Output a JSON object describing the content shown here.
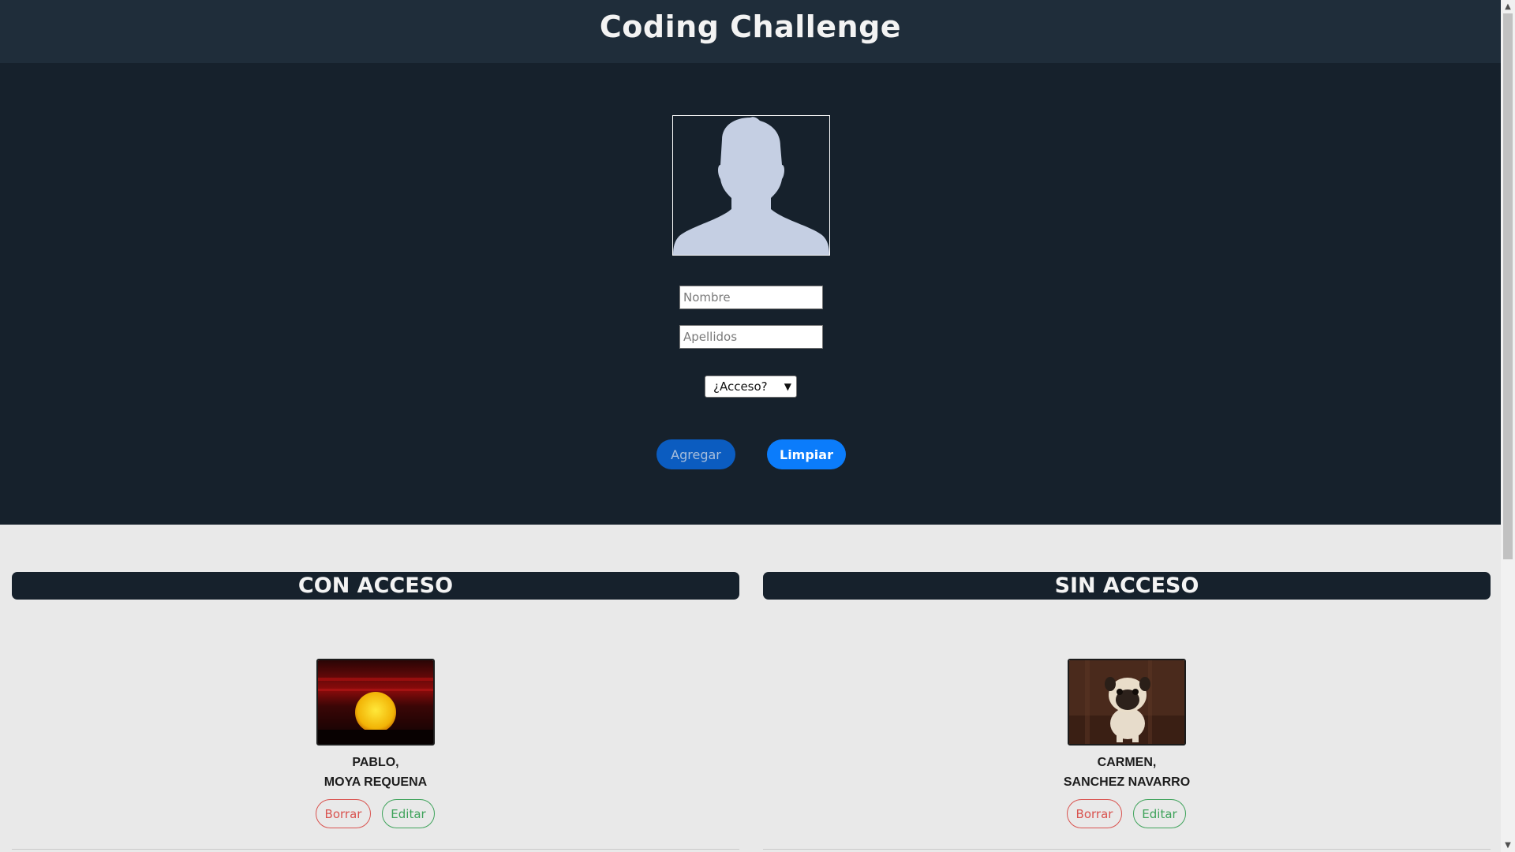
{
  "header": {
    "title": "Coding Challenge"
  },
  "form": {
    "nombre_placeholder": "Nombre",
    "apellidos_placeholder": "Apellidos",
    "access_select": {
      "selected": "¿Acceso?"
    },
    "agregar_label": "Agregar",
    "limpiar_label": "Limpiar"
  },
  "lists": {
    "con_acceso": {
      "title": "CON ACCESO",
      "items": [
        {
          "first_name": "PABLO,",
          "last_name": "MOYA REQUENA",
          "image": "sunset-photo",
          "borrar_label": "Borrar",
          "editar_label": "Editar"
        }
      ]
    },
    "sin_acceso": {
      "title": "SIN ACCESO",
      "items": [
        {
          "first_name": "CARMEN,",
          "last_name": "SANCHEZ NAVARRO",
          "image": "pug-photo",
          "borrar_label": "Borrar",
          "editar_label": "Editar"
        }
      ]
    }
  },
  "colors": {
    "header_bg": "#1f2d3a",
    "form_bg": "#16212c",
    "primary": "#0b7cfb",
    "danger": "#d9534f",
    "success": "#3fa35b"
  }
}
